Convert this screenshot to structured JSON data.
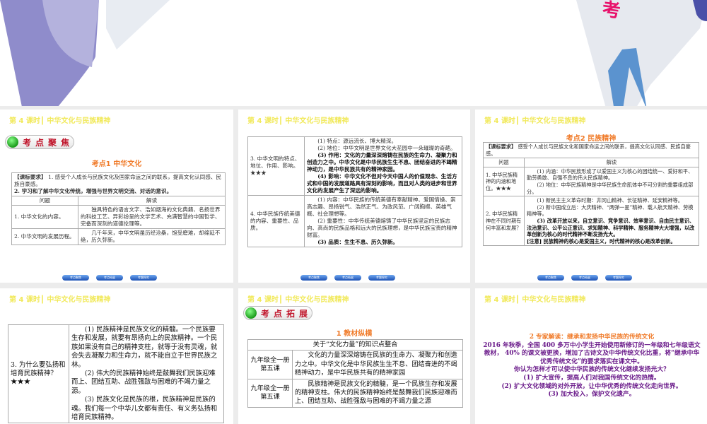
{
  "top_slide": {
    "decor_text": "考"
  },
  "lesson_title": "第 4 课时┃ 中华文化与民族精神",
  "nav_buttons": [
    "考点聚焦",
    "考点拓展",
    "考题探究"
  ],
  "slide1": {
    "badge": "考点聚焦",
    "subtitle": "考点1 中华文化",
    "req_label": "【课标要求】",
    "req1": "1. 感受个人成长与民族文化及国家命运之间的联系，提高文化认同感、民族自豪感。",
    "req2": "2. 学习和了解中华文化传统，增强与世界文明交流、对话的意识。",
    "col_q": "问题",
    "col_a": "解读",
    "rows": [
      {
        "q": "1. 中华文化的内容。",
        "a": "独具特色的语言文字、浩如烟海的文化典籍、名扬世界的科技工艺、异彩纷呈的文学艺术、充满智慧的中国哲学、完备而深刻的道德伦理等。"
      },
      {
        "q": "2. 中华文明的发展历程。",
        "a": "几千年来，中华文明虽历经沧桑，饱受磨难，却绵延不绝，历久弥新。"
      }
    ]
  },
  "slide2": {
    "rows": [
      {
        "q": "3. 中华文明的特点、地位、作用、影响。★★★",
        "a": [
          "(1) 特点：源远流长、博大精深。",
          "(2) 地位：中华文明是世界文化大花园中一朵璀璨的奇葩。",
          "(3) 作用：文化的力量深深熔铸在民族的生命力、凝聚力和创造力之中。中华文化是中华民族生生不息、团结奋进的不竭精神动力，是中华民族共有的精神家园。",
          "(4) 影响：中华文化不但对今天中国人的价值观念、生活方式和中国的发展道路具有深刻的影响，而且对人类的进步和世界文化的发展产生了深远的影响。"
        ]
      },
      {
        "q": "4. 中华民族传统美德的内容、重要性、品质。",
        "a": [
          "(1) 内容：中华民族的传统美德有奉献精神、爱国情操、崇高志趣、昂扬锐气、浩然正气、为政风范、广阔胸襟、英雄气概、社会理想等。",
          "(2) 重要性：中华传统美德熔铸了中华民族坚定的民族志向、高尚的民族品格和远大的民族理想，是中华民族宝贵的精神财富。",
          "(3) 品质：生生不息、历久弥新。"
        ]
      }
    ]
  },
  "slide3": {
    "subtitle": "考点2 民族精神",
    "req_label": "【课标要求】",
    "req": "感受个人成长与民族文化和国家命运之间的联系，提高文化认同感、民族自豪感。",
    "col_q": "问题",
    "col_a": "解读",
    "rows": [
      {
        "q": "1. 中华民族精神的内涵和地位。★★★",
        "a": [
          "(1) 内涵：中华民族形成了以爱国主义为核心的团结统一、爱好和平、勤劳勇敢、自强不息的伟大民族精神。",
          "(2) 地位：中华民族精神是中华民族生命肌体中不可分割的重要组成部分。"
        ]
      },
      {
        "q": "2. 中华民族精神在不同时期有何丰富和发展？",
        "a": [
          "(1) 新民主主义革命时期：井冈山精神、长征精神、延安精神等。",
          "(2) 新中国成立后：大庆精神、“两弹一星”精神、载人航天精神、劳模精神等。",
          "(3) 改革开放以来，自立意识、竞争意识、效率意识、自由民主意识、法治意识、公平公正意识、求知精神、科学精神、服务精神大大增强，以改革创新为核心的时代精神不断发扬光大。",
          "[注意] 民族精神的核心是爱国主义，时代精神的核心是改革创新。"
        ]
      }
    ]
  },
  "slide4": {
    "q": "3. 为什么要弘扬和培育民族精神？★★★",
    "a": [
      "(1) 民族精神是民族文化的精髓。一个民族要生存和发展，就要有昂扬向上的民族精神。一个民族如果没有自己的精神支柱，就等于没有灵魂，就会失去凝聚力和生命力，就不能自立于世界民族之林。",
      "(2) 伟大的民族精神始终是鼓舞我们民族迎难而上、团结互助、战胜强敌与困难的不竭力量之源。",
      "(3) 民族文化是民族的根，民族精神是民族的魂。我们每一个中华儿女都有责任、有义务弘扬和培育民族精神。"
    ]
  },
  "slide5": {
    "badge": "考点拓展",
    "subtitle": "1 教材纵横",
    "table_title": "关于“文化力量”的知识点整合",
    "rows": [
      {
        "q": "九年级全一册第五课",
        "a": "文化的力量深深熔铸在民族的生命力、凝聚力和创造力之中。中华文化是中华民族生生不息、团结奋进的不竭精神动力，是中华民族共有的精神家园"
      },
      {
        "q": "九年级全一册第五课",
        "a": "民族精神是民族文化的精髓，是一个民族生存和发展的精神支柱。伟大的民族精神始终是鼓舞我们民族迎难而上、团结互助、战胜强敌与困难的不竭力量之源"
      }
    ]
  },
  "slide6": {
    "heading": "2 专家解读：继承和发扬中华民族的传统文化",
    "para": "2016 年秋季，全国 400 多万中小学生开始使用新修订的一年级和七年级语文教材， 40% 的课文被更换，增加了古诗文及中华传统文化比重，将“继承中华优秀传统文化”的要求落实在课文中。",
    "question": "你认为怎样才可以使中华民族的传统文化继续发扬光大？",
    "answers": [
      "(1) 扩大宣传，提高人们对我国传统文化的热情。",
      "(2) 扩大文化领域的对外开放，让中华优秀的传统文化走向世界。",
      "(3) 加大投入，保护文化遗产。"
    ]
  }
}
